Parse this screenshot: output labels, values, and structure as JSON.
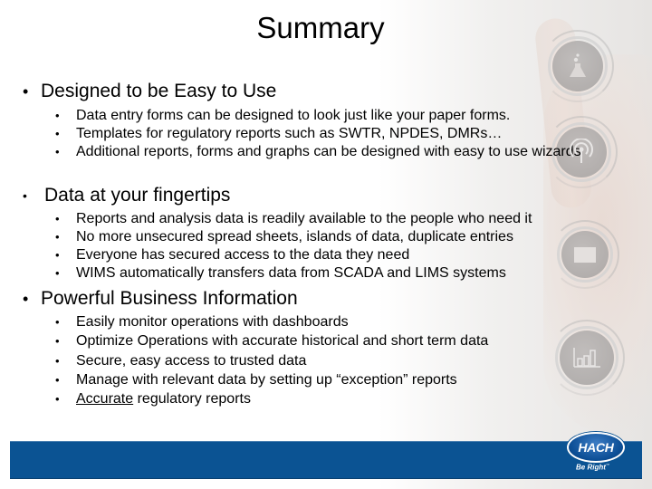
{
  "slide": {
    "title": "Summary",
    "sections": [
      {
        "heading": "Designed to be Easy to Use",
        "items": [
          "Data entry forms can be designed to look just like your paper forms.",
          "Templates for regulatory reports such as SWTR, NPDES, DMRs…",
          "Additional reports, forms and graphs can be designed with easy to use wizards"
        ]
      },
      {
        "heading": "Data at your fingertips",
        "items": [
          "Reports and analysis data is readily available to the people who need it",
          "No more unsecured spread sheets, islands of data, duplicate entries",
          "Everyone has secured access to the data they need",
          "WIMS automatically transfers data from SCADA and LIMS systems"
        ]
      },
      {
        "heading": "Powerful Business Information",
        "items": [
          "Easily monitor operations with dashboards",
          "Optimize Operations with accurate historical and short term data",
          "Secure, easy access to trusted data",
          "Manage with relevant data by setting up “exception” reports",
          {
            "underlined": "Accurate",
            "rest": " regulatory reports"
          }
        ]
      }
    ],
    "bullet": "•"
  },
  "decor": {
    "icons": [
      "flask-icon",
      "signal-icon",
      "folder-icon",
      "bar-chart-icon"
    ]
  },
  "footer": {
    "logo_text": "HACH",
    "tagline": "Be Right",
    "trademark": "™",
    "bar_color": "#0b5393"
  }
}
